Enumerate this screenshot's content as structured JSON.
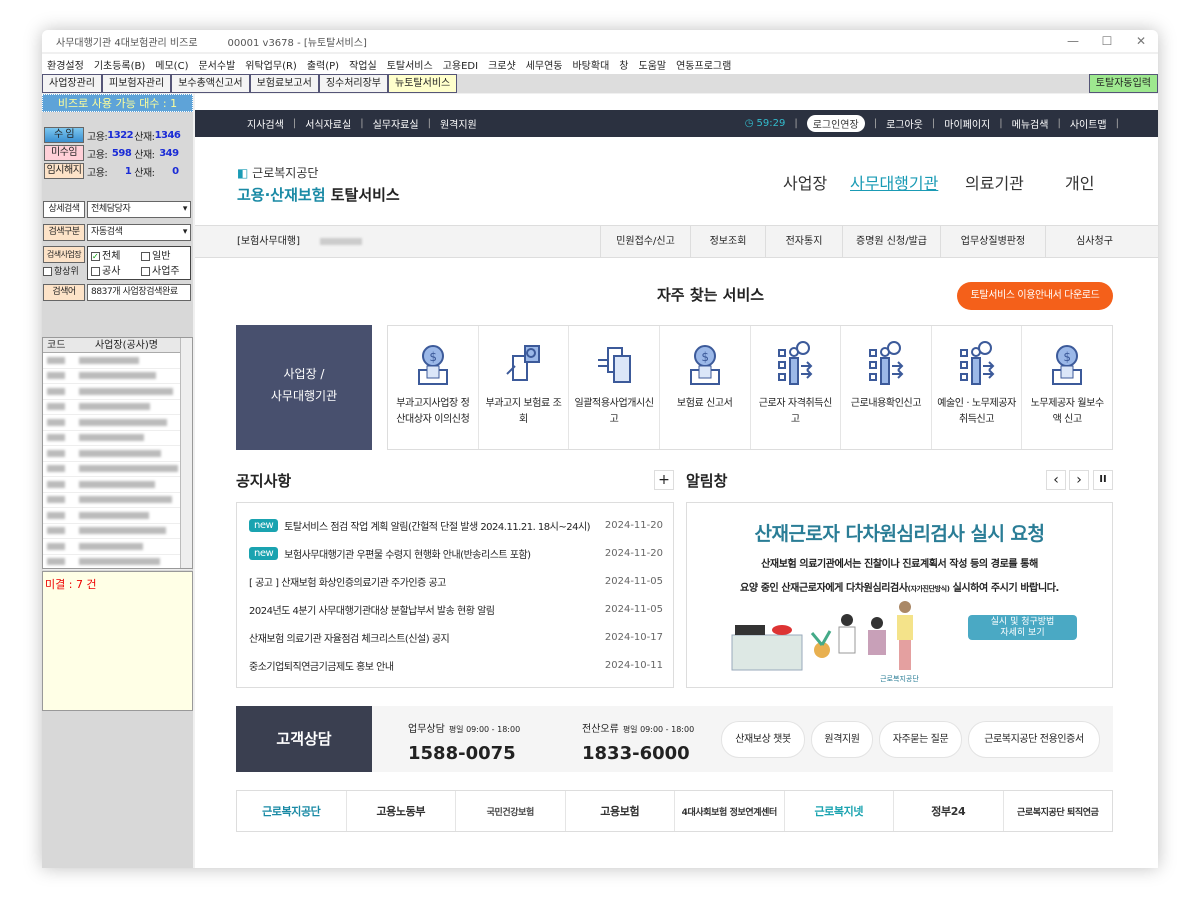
{
  "window": {
    "title": "사무대행기관 4대보험관리 비즈로",
    "version": "00001  v3678 - [뉴토탈서비스]",
    "controls": [
      "—",
      "☐",
      "✕"
    ]
  },
  "menu": [
    "환경설정",
    "기초등록(B)",
    "메모(C)",
    "문서수발",
    "위탁업무(R)",
    "출력(P)",
    "작업실",
    "토탈서비스",
    "고용EDI",
    "크로샷",
    "세무연동",
    "바탕확대",
    "창",
    "도움말",
    "연동프로그램"
  ],
  "toolbar": {
    "tabs": [
      "사업장관리",
      "피보험자관리",
      "보수총액신고서",
      "보험료보고서",
      "징수처리장부",
      "뉴토탈서비스"
    ],
    "right": "토탈자동입력"
  },
  "left": {
    "header": "비즈로 사용 가능 대수 : 1",
    "stats": [
      {
        "label": "수 임",
        "goyong": "1322",
        "sanjae": "1346"
      },
      {
        "label": "미수임",
        "goyong": "598",
        "sanjae": "349"
      },
      {
        "label": "임시해지",
        "goyong": "1",
        "sanjae": "0"
      }
    ],
    "goyong_label": "고용:",
    "sanjae_label": "산재:",
    "detail_search": "상세검색",
    "detail_value": "전체담당자",
    "search_type": "검색구분",
    "search_type_value": "자동검색",
    "search_biz": "검색사업장",
    "always_top": "항상위",
    "checks": [
      "전체",
      "일반",
      "공사",
      "사업주"
    ],
    "keyword": "검색어",
    "keyword_value": "8837개 사업장검색완료",
    "col_code": "코드",
    "col_name": "사업장(공사)명",
    "pending": "미결 : 7 건"
  },
  "web": {
    "topbar": {
      "left": [
        "지사검색",
        "서식자료실",
        "실무자료실",
        "원격지원"
      ],
      "timer": "59:29",
      "login_extend": "로그인연장",
      "right": [
        "로그아웃",
        "마이페이지",
        "메뉴검색",
        "사이트맵"
      ]
    },
    "logo": {
      "org": "근로복지공단",
      "line1": "고용·산재보험",
      "line2": "토탈서비스"
    },
    "gnb": [
      "사업장",
      "사무대행기관",
      "의료기관",
      "개인"
    ],
    "subnav": {
      "label": "[보험사무대행]",
      "items": [
        "민원접수/신고",
        "정보조회",
        "전자통지",
        "증명원 신청/발급",
        "업무상질병판정",
        "심사청구"
      ]
    },
    "services": {
      "title": "자주 찾는 서비스",
      "download": "토탈서비스 이용안내서 다운로드",
      "category": [
        "사업장 /",
        "사무대행기관"
      ],
      "items": [
        "부과고지사업장 정산대상자 이의신청",
        "부과고지 보험료 조회",
        "일괄적용사업개시신고",
        "보험료 신고서",
        "근로자 자격취득신고",
        "근로내용확인신고",
        "예술인 · 노무제공자 취득신고",
        "노무제공자 월보수액 신고"
      ]
    },
    "notices": {
      "title": "공지사항",
      "more": "+",
      "new_badge": "new",
      "items": [
        {
          "new": true,
          "title": "토탈서비스 점검 작업 계획 알림(간헐적 단절 발생 2024.11.21. 18시~24시)",
          "date": "2024-11-20"
        },
        {
          "new": true,
          "title": "보험사무대행기관 우편물 수령지 현행화 안내(반송리스트 포함)",
          "date": "2024-11-20"
        },
        {
          "new": false,
          "title": "[ 공고 ] 산재보험 화상인증의료기관 주가인증 공고",
          "date": "2024-11-05"
        },
        {
          "new": false,
          "title": "2024년도 4분기 사무대행기관대상 분할납부서 발송 현황 알림",
          "date": "2024-11-05"
        },
        {
          "new": false,
          "title": "산재보험 의료기관 자율점검 체크리스트(신설) 공지",
          "date": "2024-10-17"
        },
        {
          "new": false,
          "title": "중소기업퇴직연금기금제도 홍보 안내",
          "date": "2024-10-11"
        }
      ]
    },
    "alert": {
      "title": "알림창",
      "headline": "산재근로자 다차원심리검사 실시 요청",
      "line1": "산재보험 의료기관에서는 진찰이나 진료계획서 작성 등의 경로를 통해",
      "line2a": "요양 중인 산재근로자에게 다차원심리검사",
      "line2b": "(자가진단방식)",
      "line2c": " 실시하여 주시기 바랍니다.",
      "button1": "실시 및 청구방법",
      "button2": "자세히 보기",
      "footer": "근로복지공단",
      "prev": "‹",
      "next": "›",
      "pause": "II"
    },
    "customer": {
      "title": "고객상담",
      "phones": [
        {
          "label": "업무상담",
          "hours": "평일 09:00 - 18:00",
          "number": "1588-0075"
        },
        {
          "label": "전산오류",
          "hours": "평일 09:00 - 18:00",
          "number": "1833-6000"
        }
      ],
      "links": [
        "산재보상 챗봇",
        "원격지원",
        "자주묻는 질문",
        "근로복지공단 전용인증서"
      ]
    },
    "partners": [
      "근로복지공단",
      "고용노동부",
      "국민건강보험",
      "고용보험",
      "4대사회보험 정보연계센터",
      "근로복지넷",
      "정부24",
      "근로복지공단 퇴직연금"
    ]
  },
  "colors": {
    "accent": "#1a9bb5",
    "orange": "#f4601a",
    "dark": "#2b3140"
  }
}
